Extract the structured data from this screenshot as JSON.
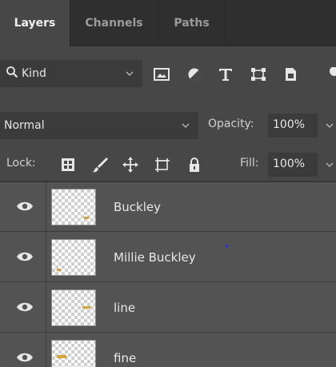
{
  "tabs": [
    {
      "label": "Layers",
      "active": true
    },
    {
      "label": "Channels",
      "active": false
    },
    {
      "label": "Paths",
      "active": false
    }
  ],
  "filter": {
    "kind_label": "Kind",
    "icons": [
      "image-filter-icon",
      "adjustment-filter-icon",
      "type-filter-icon",
      "shape-filter-icon",
      "smart-object-filter-icon"
    ]
  },
  "blend": {
    "mode": "Normal",
    "opacity_label": "Opacity:",
    "opacity_value": "100%"
  },
  "lock": {
    "label": "Lock:",
    "icons": [
      "lock-transparent-pixels-icon",
      "lock-image-pixels-icon",
      "lock-position-icon",
      "lock-artboard-icon",
      "lock-all-icon"
    ],
    "fill_label": "Fill:",
    "fill_value": "100%"
  },
  "layers": [
    {
      "name": "Buckley",
      "visible": true
    },
    {
      "name": "Millie Buckley",
      "visible": true
    },
    {
      "name": "line",
      "visible": true
    },
    {
      "name": "fine",
      "visible": true
    }
  ],
  "colors": {
    "panel_bg": "#535353",
    "header_bg": "#474747",
    "tabbar_bg": "#2f2f2f",
    "input_bg": "#3b3b3b",
    "text": "#e6e6e6",
    "thumb_mark": "#d6a23a"
  }
}
